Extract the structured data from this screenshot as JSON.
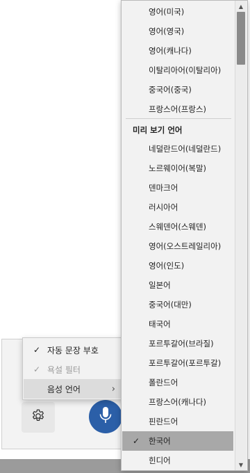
{
  "context_menu": {
    "items": [
      {
        "label": "자동 문장 부호",
        "checked": true,
        "enabled": true
      },
      {
        "label": "욕설 필터",
        "checked": true,
        "enabled": false
      },
      {
        "label": "음성 언어",
        "submenu": true,
        "highlighted": true
      }
    ]
  },
  "language_menu": {
    "languages_top": [
      {
        "label": "영어(미국)"
      },
      {
        "label": "영어(영국)"
      },
      {
        "label": "영어(캐나다)"
      },
      {
        "label": "이탈리아어(이탈리아)"
      },
      {
        "label": "중국어(중국)"
      },
      {
        "label": "프랑스어(프랑스)"
      }
    ],
    "preview_header": "미리 보기 언어",
    "languages_preview": [
      {
        "label": "네덜란드어(네덜란드)"
      },
      {
        "label": "노르웨이어(복말)"
      },
      {
        "label": "덴마크어"
      },
      {
        "label": "러시아어"
      },
      {
        "label": "스웨덴어(스웨덴)"
      },
      {
        "label": "영어(오스트레일리아)"
      },
      {
        "label": "영어(인도)"
      },
      {
        "label": "일본어"
      },
      {
        "label": "중국어(대만)"
      },
      {
        "label": "태국어"
      },
      {
        "label": "포르투갈어(브라질)"
      },
      {
        "label": "포르투갈어(포르투갈)"
      },
      {
        "label": "폴란드어"
      },
      {
        "label": "프랑스어(캐나다)"
      },
      {
        "label": "핀란드어"
      },
      {
        "label": "한국어",
        "selected": true
      },
      {
        "label": "힌디어"
      }
    ]
  },
  "icons": {
    "settings": "gear-icon",
    "microphone": "microphone-icon",
    "check": "checkmark-icon",
    "submenu_arrow": "chevron-right-icon"
  },
  "colors": {
    "mic_button": "#2b5fa8",
    "selected_item": "#a8a8a8",
    "menu_bg": "#f2f2f2"
  }
}
